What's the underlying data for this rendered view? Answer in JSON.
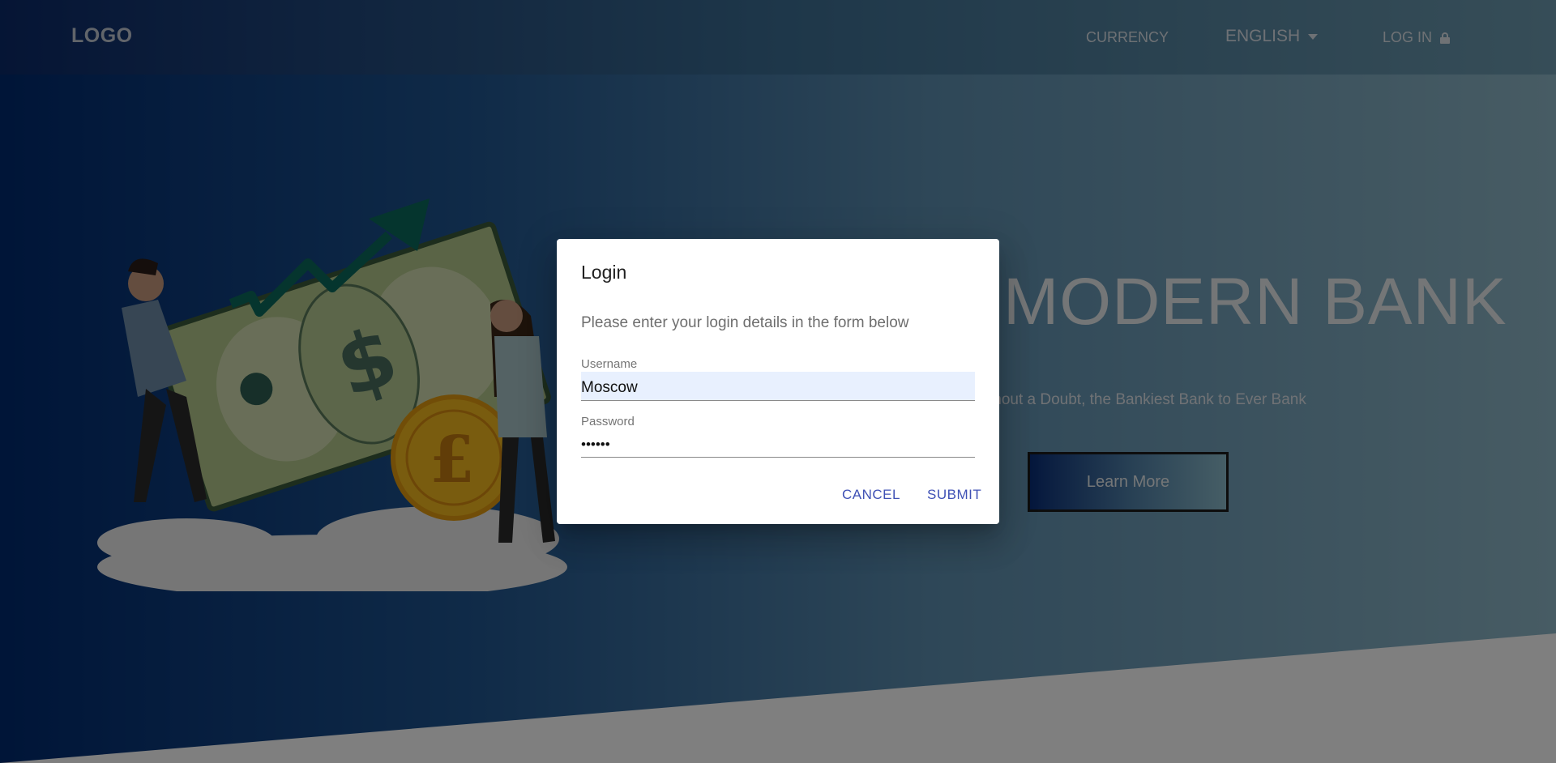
{
  "navbar": {
    "logo": "LOGO",
    "currency": "CURRENCY",
    "language": "ENGLISH",
    "login": "LOG IN"
  },
  "hero": {
    "title": "MODERN BANK",
    "subtitle": "thout a Doubt, the Bankiest Bank to Ever Bank",
    "cta": "Learn More"
  },
  "dialog": {
    "title": "Login",
    "text": "Please enter your login details in the form below",
    "username_label": "Username",
    "username_value": "Moscow",
    "password_label": "Password",
    "password_value": "••••••",
    "cancel": "CANCEL",
    "submit": "SUBMIT"
  },
  "colors": {
    "accent": "#3f51b5",
    "autofill_bg": "#e8f0fe"
  }
}
